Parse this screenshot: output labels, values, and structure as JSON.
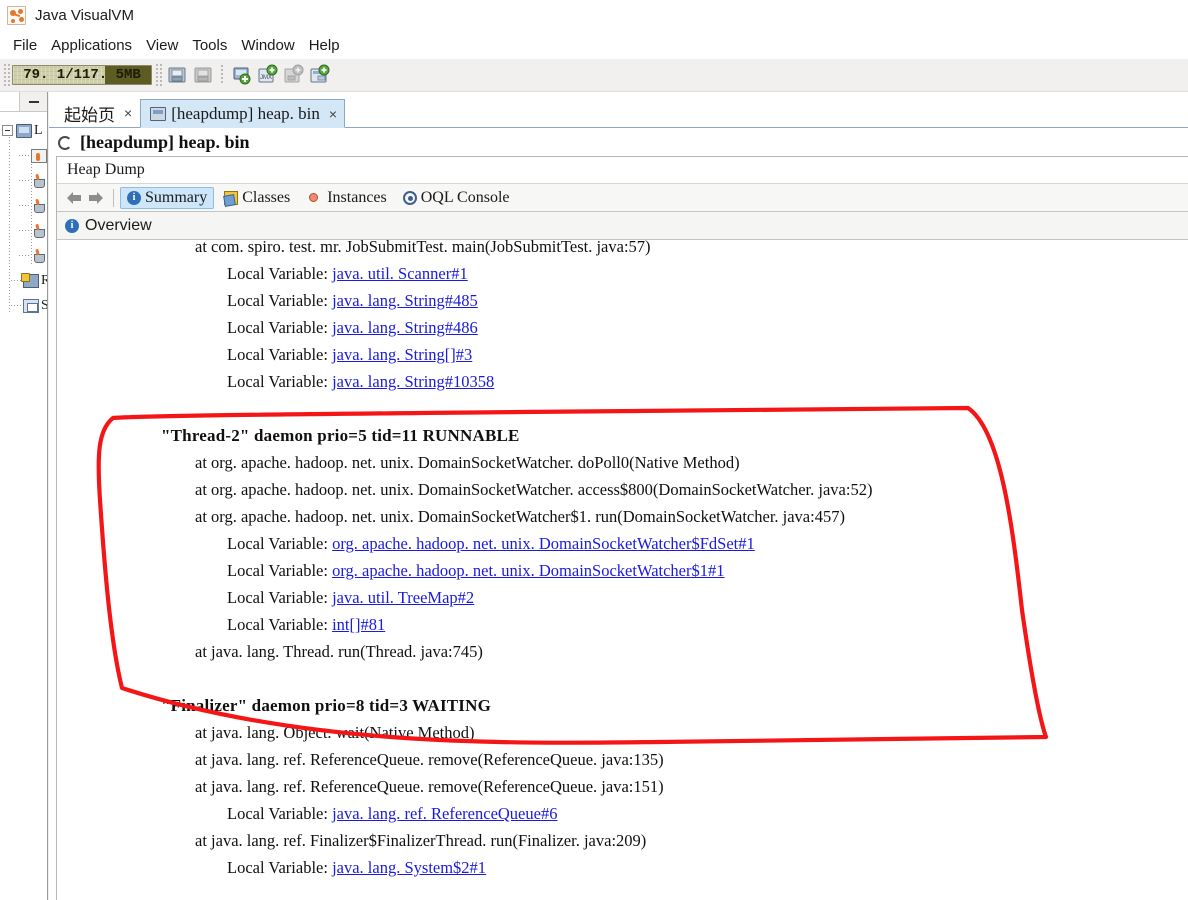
{
  "window": {
    "title": "Java VisualVM",
    "app_icon": "visualvm-icon"
  },
  "menubar": {
    "items": [
      "File",
      "Applications",
      "View",
      "Tools",
      "Window",
      "Help"
    ]
  },
  "toolbar": {
    "memory_gauge": {
      "label": "79. 1/117. 5MB",
      "used_mb": 79.1,
      "total_mb": 117.5,
      "percent": 67
    },
    "buttons": [
      {
        "name": "open-snapshot-icon",
        "enabled": true
      },
      {
        "name": "save-snapshot-icon",
        "enabled": false
      },
      {
        "name": "add-remote-host-icon",
        "enabled": true
      },
      {
        "name": "add-jmx-connection-icon",
        "enabled": true
      },
      {
        "name": "add-vm-coredump-icon",
        "enabled": false
      },
      {
        "name": "add-application-icon",
        "enabled": true
      }
    ]
  },
  "sidebar": {
    "minimize_label": "minimize",
    "nodes": [
      {
        "label": "L",
        "icon": "monitor-icon",
        "depth": 0,
        "expander": true
      },
      {
        "label": "",
        "icon": "app-window-icon",
        "depth": 1
      },
      {
        "label": "",
        "icon": "coffee-cup-icon",
        "depth": 1
      },
      {
        "label": "",
        "icon": "coffee-cup-icon",
        "depth": 1
      },
      {
        "label": "",
        "icon": "coffee-cup-icon",
        "depth": 1
      },
      {
        "label": "",
        "icon": "coffee-cup-icon",
        "depth": 1
      },
      {
        "label": "R",
        "icon": "remote-host-icon",
        "depth": 0
      },
      {
        "label": "S",
        "icon": "snapshots-icon",
        "depth": 0
      }
    ]
  },
  "tabs": [
    {
      "label": "起始页",
      "active": false,
      "closable": true,
      "icon": null
    },
    {
      "label": "[heapdump] heap. bin",
      "active": true,
      "closable": true,
      "icon": "heapdump-icon"
    }
  ],
  "document": {
    "title": "[heapdump] heap. bin",
    "spinner": "loading-spinner"
  },
  "heapdump": {
    "section_label": "Heap Dump",
    "view_tabs": [
      {
        "label": "Summary",
        "icon": "info-icon",
        "selected": true
      },
      {
        "label": "Classes",
        "icon": "classes-icon",
        "selected": false
      },
      {
        "label": "Instances",
        "icon": "instances-icon",
        "selected": false
      },
      {
        "label": "OQL Console",
        "icon": "oql-icon",
        "selected": false
      }
    ],
    "nav": {
      "back": "back-arrow",
      "forward": "forward-arrow"
    },
    "overview_label": "Overview"
  },
  "stack": {
    "lines": [
      {
        "type": "at",
        "prefix": "at com. spiro. test. mr. JobSubmitTest. main(JobSubmitTest. java:57)",
        "link": null,
        "clipped": true
      },
      {
        "type": "lv",
        "prefix": "Local Variable: ",
        "link": "java. util. Scanner#1"
      },
      {
        "type": "lv",
        "prefix": "Local Variable: ",
        "link": "java. lang. String#485"
      },
      {
        "type": "lv",
        "prefix": "Local Variable: ",
        "link": "java. lang. String#486"
      },
      {
        "type": "lv",
        "prefix": "Local Variable: ",
        "link": "java. lang. String[]#3"
      },
      {
        "type": "lv",
        "prefix": "Local Variable: ",
        "link": "java. lang. String#10358"
      },
      {
        "type": "blank",
        "prefix": "",
        "link": null
      },
      {
        "type": "thread",
        "prefix": "\"Thread-2\" daemon prio=5 tid=11 RUNNABLE",
        "link": null
      },
      {
        "type": "at",
        "prefix": "at org. apache. hadoop. net. unix. DomainSocketWatcher. doPoll0(Native Method)",
        "link": null
      },
      {
        "type": "at",
        "prefix": "at org. apache. hadoop. net. unix. DomainSocketWatcher. access$800(DomainSocketWatcher. java:52)",
        "link": null
      },
      {
        "type": "at",
        "prefix": "at org. apache. hadoop. net. unix. DomainSocketWatcher$1. run(DomainSocketWatcher. java:457)",
        "link": null
      },
      {
        "type": "lv",
        "prefix": "Local Variable: ",
        "link": "org. apache. hadoop. net. unix. DomainSocketWatcher$FdSet#1"
      },
      {
        "type": "lv",
        "prefix": "Local Variable: ",
        "link": "org. apache. hadoop. net. unix. DomainSocketWatcher$1#1"
      },
      {
        "type": "lv",
        "prefix": "Local Variable: ",
        "link": "java. util. TreeMap#2"
      },
      {
        "type": "lv",
        "prefix": "Local Variable: ",
        "link": "int[]#81"
      },
      {
        "type": "at",
        "prefix": "at java. lang. Thread. run(Thread. java:745)",
        "link": null
      },
      {
        "type": "blank",
        "prefix": "",
        "link": null
      },
      {
        "type": "thread",
        "prefix": "\"Finalizer\" daemon prio=8 tid=3 WAITING",
        "link": null
      },
      {
        "type": "at",
        "prefix": "at java. lang. Object. wait(Native Method)",
        "link": null
      },
      {
        "type": "at",
        "prefix": "at java. lang. ref. ReferenceQueue. remove(ReferenceQueue. java:135)",
        "link": null
      },
      {
        "type": "at",
        "prefix": "at java. lang. ref. ReferenceQueue. remove(ReferenceQueue. java:151)",
        "link": null
      },
      {
        "type": "lv",
        "prefix": "Local Variable: ",
        "link": "java. lang. ref. ReferenceQueue#6"
      },
      {
        "type": "at",
        "prefix": "at java. lang. ref. Finalizer$FinalizerThread. run(Finalizer. java:209)",
        "link": null
      },
      {
        "type": "lv",
        "prefix": "Local Variable: ",
        "link": "java. lang. System$2#1"
      }
    ]
  },
  "annotation": {
    "name": "red-hand-drawn-highlight",
    "color": "#f41616",
    "stroke_width": 4,
    "shape": "irregular-closed-loop-around-thread-2-stack"
  },
  "colors": {
    "accent": "#cde6fa",
    "link": "#1a1ae0",
    "annotation": "#f41616",
    "tab_active": "#d3e7f7",
    "gauge_fill": "#cfcfa8",
    "gauge_bg": "#5e5c22"
  }
}
